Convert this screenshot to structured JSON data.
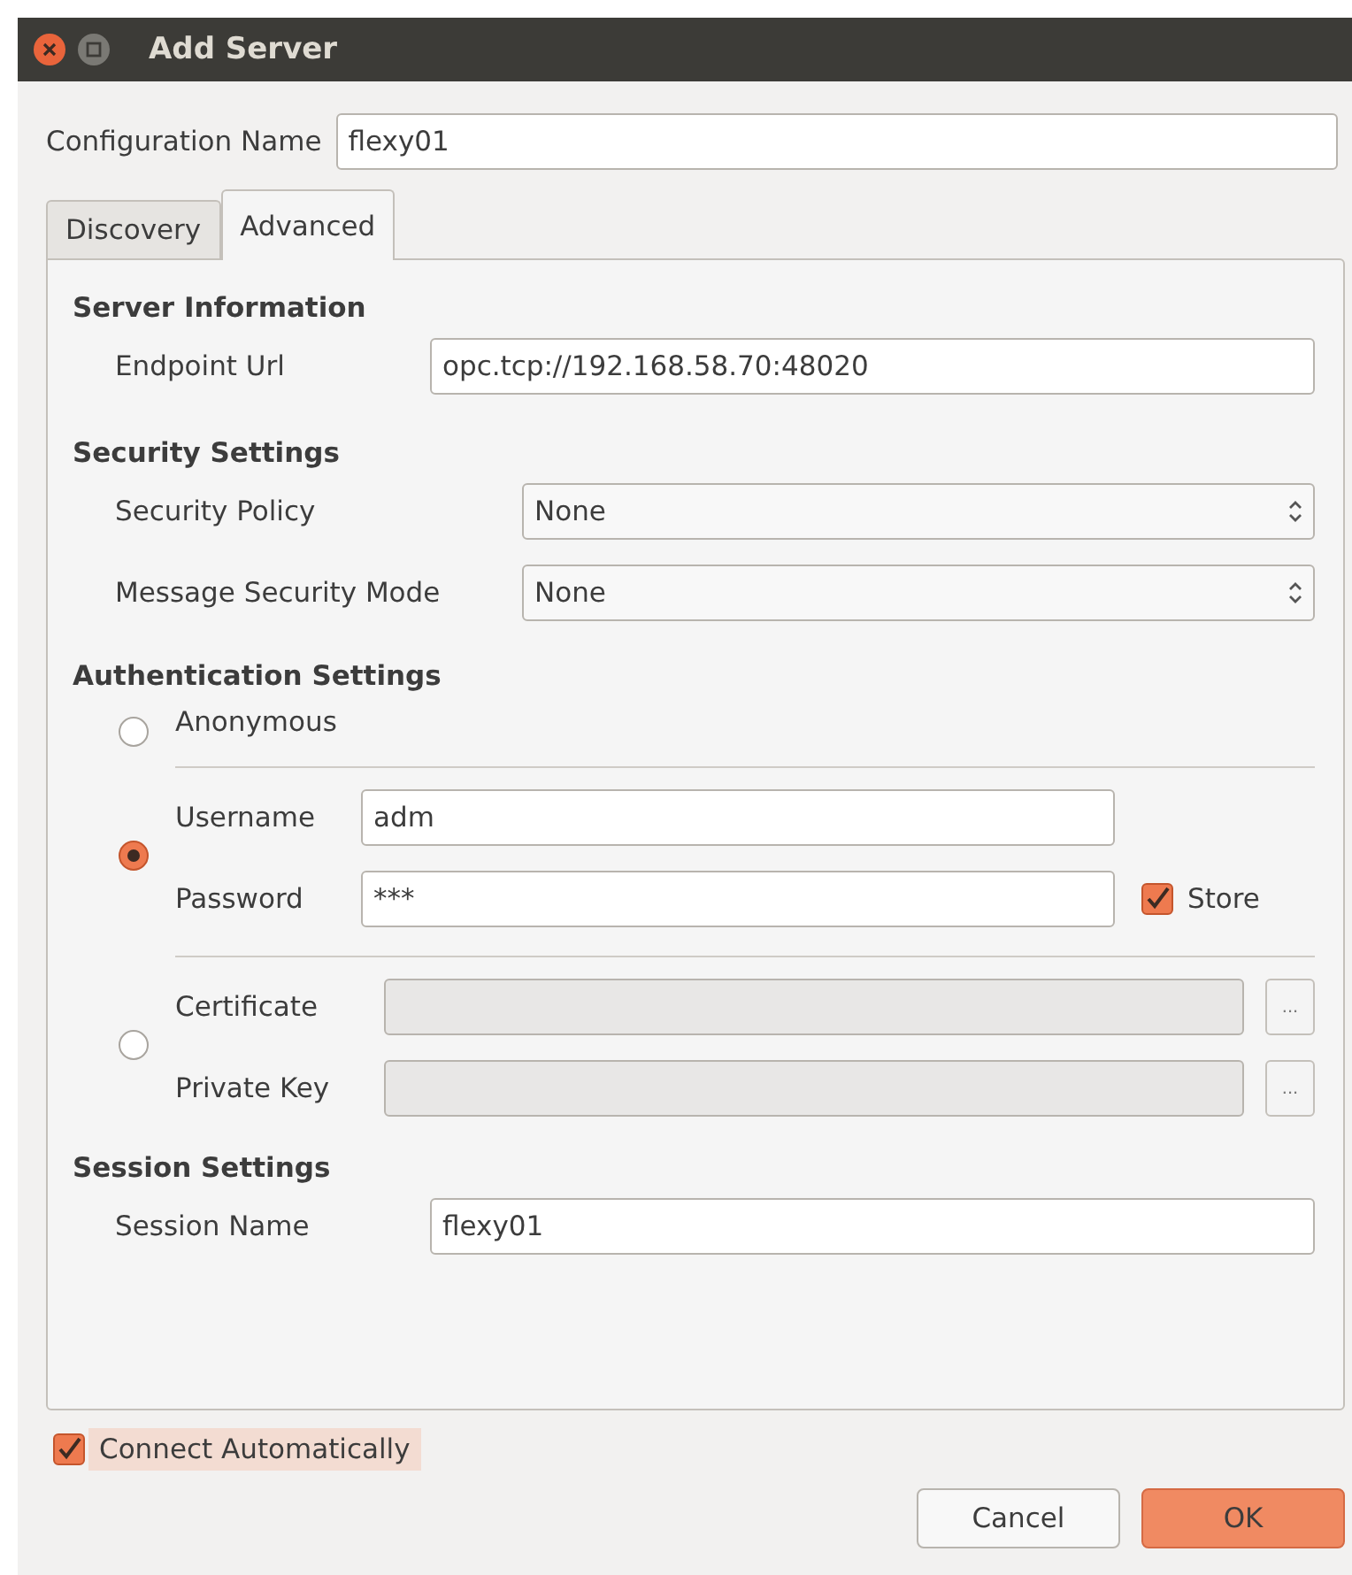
{
  "window": {
    "title": "Add Server"
  },
  "configuration_name": {
    "label": "Configuration Name",
    "value": "flexy01"
  },
  "tabs": [
    {
      "label": "Discovery",
      "selected": false
    },
    {
      "label": "Advanced",
      "selected": true
    }
  ],
  "server_information": {
    "heading": "Server Information",
    "endpoint_label": "Endpoint Url",
    "endpoint_value": "opc.tcp://192.168.58.70:48020"
  },
  "security_settings": {
    "heading": "Security Settings",
    "rows": [
      {
        "label": "Security Policy",
        "value": "None"
      },
      {
        "label": "Message Security Mode",
        "value": "None"
      }
    ]
  },
  "authentication": {
    "heading": "Authentication Settings",
    "options": [
      {
        "kind": "anonymous",
        "selected": false,
        "label": "Anonymous"
      },
      {
        "kind": "credentials",
        "selected": true,
        "fields": [
          {
            "label": "Username",
            "value": "adm"
          },
          {
            "label": "Password",
            "value": "***",
            "store_label": "Store",
            "store_checked": true
          }
        ]
      },
      {
        "kind": "certificate",
        "selected": false,
        "fields": [
          {
            "label": "Certificate",
            "browse": "..."
          },
          {
            "label": "Private Key",
            "browse": "..."
          }
        ]
      }
    ]
  },
  "session_settings": {
    "heading": "Session Settings",
    "label": "Session Name",
    "value": "flexy01"
  },
  "connect_automatically": {
    "label": "Connect Automatically",
    "checked": true
  },
  "buttons": [
    {
      "label": "Cancel",
      "kind": "normal"
    },
    {
      "label": "OK",
      "kind": "default"
    }
  ]
}
